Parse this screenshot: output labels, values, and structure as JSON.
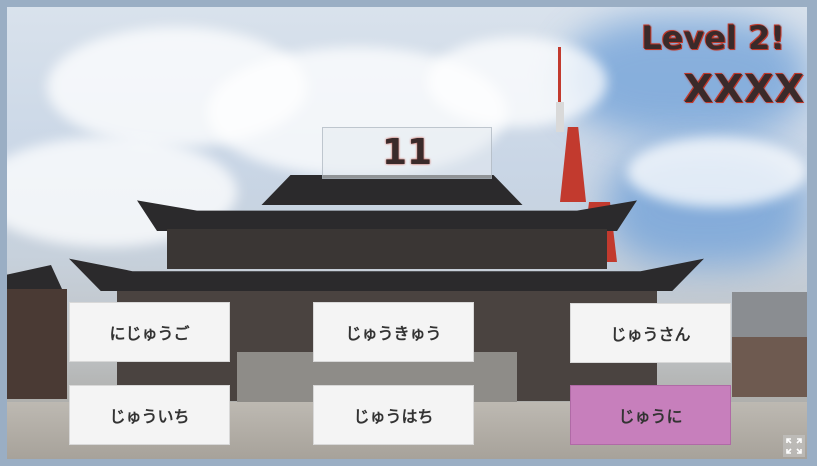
{
  "game": {
    "level_text": "Level 2!",
    "lives_text": "XXXX",
    "question_number": "11"
  },
  "answers": [
    {
      "label": "にじゅうご"
    },
    {
      "label": "じゅうきゅう"
    },
    {
      "label": "じゅうさん"
    },
    {
      "label": "じゅういち"
    },
    {
      "label": "じゅうはち"
    },
    {
      "label": "じゅうに"
    }
  ],
  "colors": {
    "highlight": "#c77fbc",
    "button": "#f4f4f4",
    "title_text": "#3a2a2a",
    "title_outline": "#c0392b"
  },
  "icons": {
    "fullscreen": "fullscreen-icon"
  }
}
